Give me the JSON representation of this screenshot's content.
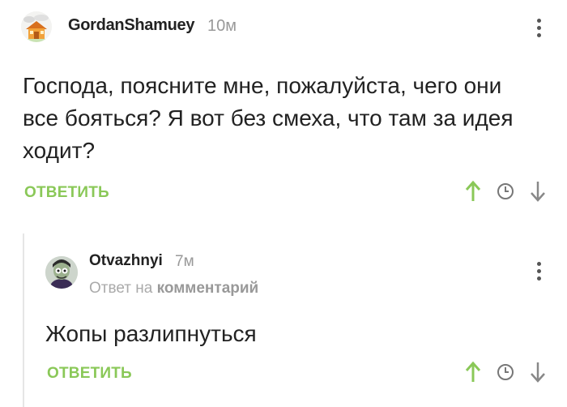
{
  "comment": {
    "author": "GordanShamuey",
    "time": "10м",
    "text_lines": [
      "Господа, поясните мне, пожалуйста, чего они",
      "все бояться? Я вот без смеха, что там за идея",
      "ходит?"
    ],
    "reply_label": "ОТВЕТИТЬ"
  },
  "reply": {
    "author": "Otvazhnyi",
    "time": "7м",
    "answer_prefix": "Ответ на",
    "answer_target": "комментарий",
    "text": "Жопы разлипнуться",
    "reply_label": "ОТВЕТИТЬ"
  },
  "icons": {
    "upvote": "arrow-up-icon",
    "clock": "clock-icon",
    "downvote": "arrow-down-icon",
    "menu": "kebab-menu-icon"
  },
  "colors": {
    "accent": "#8ac858",
    "upvote": "#8ac858",
    "muted": "#999999"
  }
}
